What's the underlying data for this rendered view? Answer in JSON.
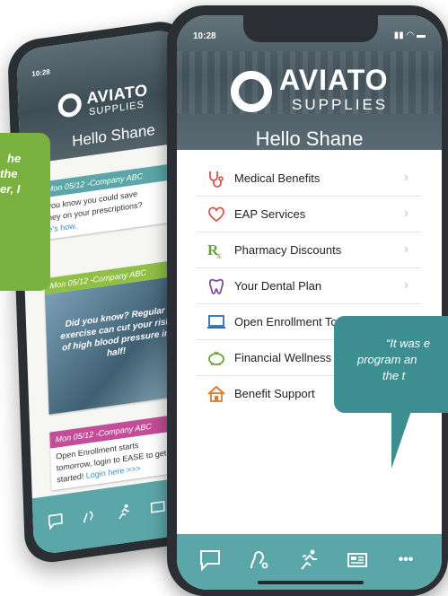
{
  "back_phone": {
    "status_time": "10:28",
    "brand": "AVIATO",
    "brand_sub": "SUPPLIES",
    "greeting": "Hello Shane",
    "cards": [
      {
        "header": "Mon 05/12 -Company ABC",
        "body": "you know you could save",
        "body2": "ney on your prescriptions?",
        "link": "e's how.",
        "color": "#5ba6a9"
      },
      {
        "header": "Mon 05/12 -Company ABC",
        "body": "Did you know? Regular exercise can cut your risk of high blood pressure in half!",
        "color": "#8fbf45"
      },
      {
        "header": "Mon 05/12 -Company ABC",
        "body": "Open Enrollment starts",
        "body2": "tomorrow, login to EASE to get",
        "body3": "started!",
        "link": "Login here >>>",
        "color": "#c34d98"
      }
    ]
  },
  "front_phone": {
    "status_time": "10:28",
    "status_icons": "▮▮ ◠ ▬",
    "brand": "AVIATO",
    "brand_sub": "SUPPLIES",
    "greeting": "Hello Shane",
    "menu": [
      {
        "label": "Medical Benefits",
        "icon": "stethoscope-icon",
        "color": "#d9534f"
      },
      {
        "label": "EAP Services",
        "icon": "heart-icon",
        "color": "#d9534f"
      },
      {
        "label": "Pharmacy Discounts",
        "icon": "rx-icon",
        "color": "#6aa33a"
      },
      {
        "label": "Your Dental Plan",
        "icon": "tooth-icon",
        "color": "#7b4fa3"
      },
      {
        "label": "Open Enrollment Tool",
        "icon": "laptop-icon",
        "color": "#2a6fb5"
      },
      {
        "label": "Financial Wellness",
        "icon": "piggy-bank-icon",
        "color": "#6aa33a"
      },
      {
        "label": "Benefit Support",
        "icon": "house-icon",
        "color": "#e07a2e"
      }
    ],
    "chevron": "›",
    "tabbar_color": "#5ba6a9",
    "more_label": "•••"
  },
  "quotes": {
    "left": [
      "he",
      "the",
      "er, I"
    ],
    "right": [
      "“It was e",
      "program an",
      "the t"
    ]
  }
}
